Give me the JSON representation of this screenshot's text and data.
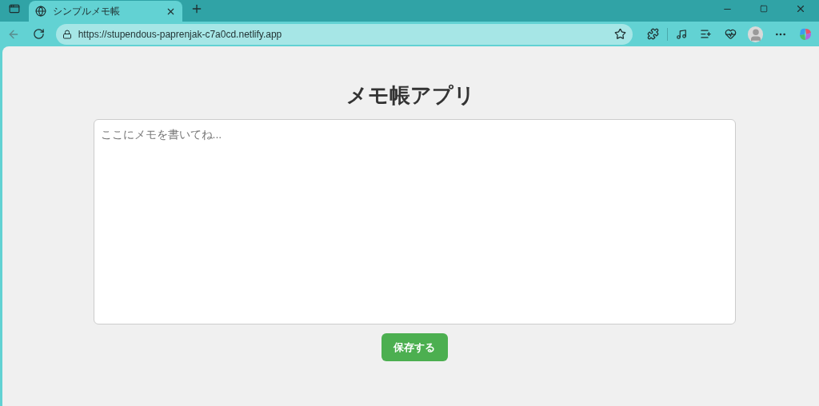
{
  "browser": {
    "tabs": [
      {
        "title": "シンプルメモ帳",
        "selected": true
      }
    ],
    "url": "https://stupendous-paprenjak-c7a0cd.netlify.app"
  },
  "page": {
    "heading": "メモ帳アプリ",
    "memo": {
      "placeholder": "ここにメモを書いてね..."
    },
    "save_button": "保存する"
  }
}
